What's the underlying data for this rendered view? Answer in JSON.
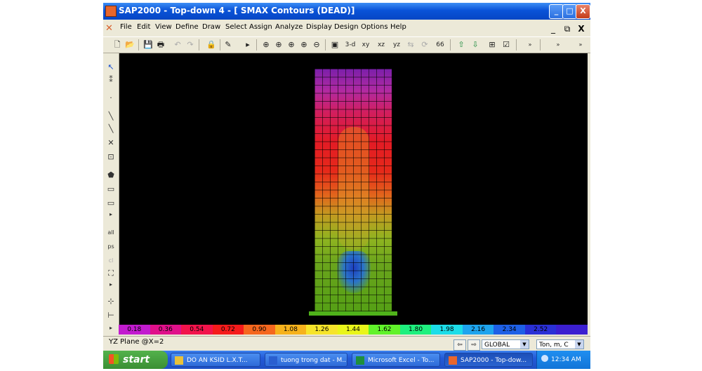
{
  "window": {
    "title": "SAP2000 - Top-down 4 - [  SMAX Contours   (DEAD)]",
    "controls": {
      "minimize": "_",
      "maximize": "□",
      "close": "X"
    }
  },
  "menu": {
    "items": [
      "File",
      "Edit",
      "View",
      "Define",
      "Draw",
      "Select",
      "Assign",
      "Analyze",
      "Display",
      "Design",
      "Options",
      "Help"
    ],
    "mdi_controls": {
      "minimize": "_",
      "restore": "⧉",
      "close": "X"
    }
  },
  "toolbar": {
    "text_buttons": {
      "view3d": "3-d",
      "xy": "xy",
      "xz": "xz",
      "yz": "yz"
    }
  },
  "contour_scale": {
    "labels": [
      "0.18",
      "0.36",
      "0.54",
      "0.72",
      "0.90",
      "1.08",
      "1.26",
      "1.44",
      "1.62",
      "1.80",
      "1.98",
      "2.16",
      "2.34",
      "2.52"
    ],
    "colors": [
      "#c21bcf",
      "#e0108a",
      "#f2134b",
      "#f51b1b",
      "#f5671e",
      "#f6b21c",
      "#f6e42a",
      "#e9f51a",
      "#61f22a",
      "#1ef07e",
      "#1cdde8",
      "#1ea4ee",
      "#1e60e6",
      "#2a30d6",
      "#3b1fd0"
    ]
  },
  "status": {
    "plane": "YZ Plane @X=2",
    "coord_system": "GLOBAL",
    "units": "Ton, m, C"
  },
  "taskbar": {
    "start_label": "start",
    "tasks": [
      {
        "label": "DO AN KSID  L.X.T...",
        "color": "#e8c13a"
      },
      {
        "label": "tuong trong dat - M...",
        "color": "#2a5fd0"
      },
      {
        "label": "Microsoft Excel - To...",
        "color": "#1e8f3c"
      },
      {
        "label": "SAP2000 - Top-dow...",
        "color": "#e8662c"
      }
    ],
    "clock": "12:34 AM"
  }
}
